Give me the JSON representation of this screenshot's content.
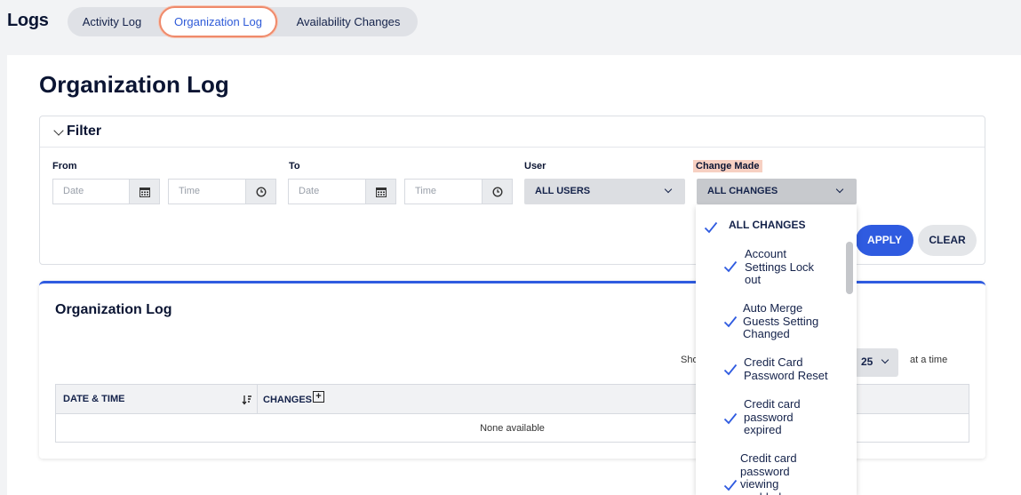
{
  "header": {
    "title": "Logs",
    "tabs": [
      {
        "label": "Activity Log"
      },
      {
        "label": "Organization Log"
      },
      {
        "label": "Availability Changes"
      }
    ]
  },
  "page": {
    "title": "Organization Log"
  },
  "filter": {
    "label": "Filter",
    "from_label": "From",
    "to_label": "To",
    "user_label": "User",
    "change_label": "Change Made",
    "date_placeholder": "Date",
    "time_placeholder": "Time",
    "user_value": "ALL USERS",
    "change_value": "ALL CHANGES",
    "apply": "APPLY",
    "clear": "CLEAR"
  },
  "log": {
    "title": "Organization Log",
    "show_prefix": "Sho",
    "per_page": "25",
    "at_a_time": "at a time",
    "col_date": "DATE & TIME",
    "col_changes": "CHANGES",
    "plus": "+",
    "empty": "None available"
  },
  "dropdown": {
    "all": "ALL CHANGES",
    "items": [
      {
        "lines": [
          "Account",
          "Settings Lock",
          "out"
        ]
      },
      {
        "lines": [
          "Auto Merge",
          "Guests Setting",
          "Changed"
        ]
      },
      {
        "lines": [
          "Credit Card",
          "Password Reset"
        ]
      },
      {
        "lines": [
          "Credit card",
          "password",
          "expired"
        ]
      },
      {
        "lines": [
          "Credit card",
          "password",
          "viewing",
          "enabled"
        ]
      }
    ]
  },
  "colors": {
    "accent": "#2f5be0",
    "tab_highlight": "#ef8a6b",
    "label_highlight": "#f7d0c2"
  }
}
